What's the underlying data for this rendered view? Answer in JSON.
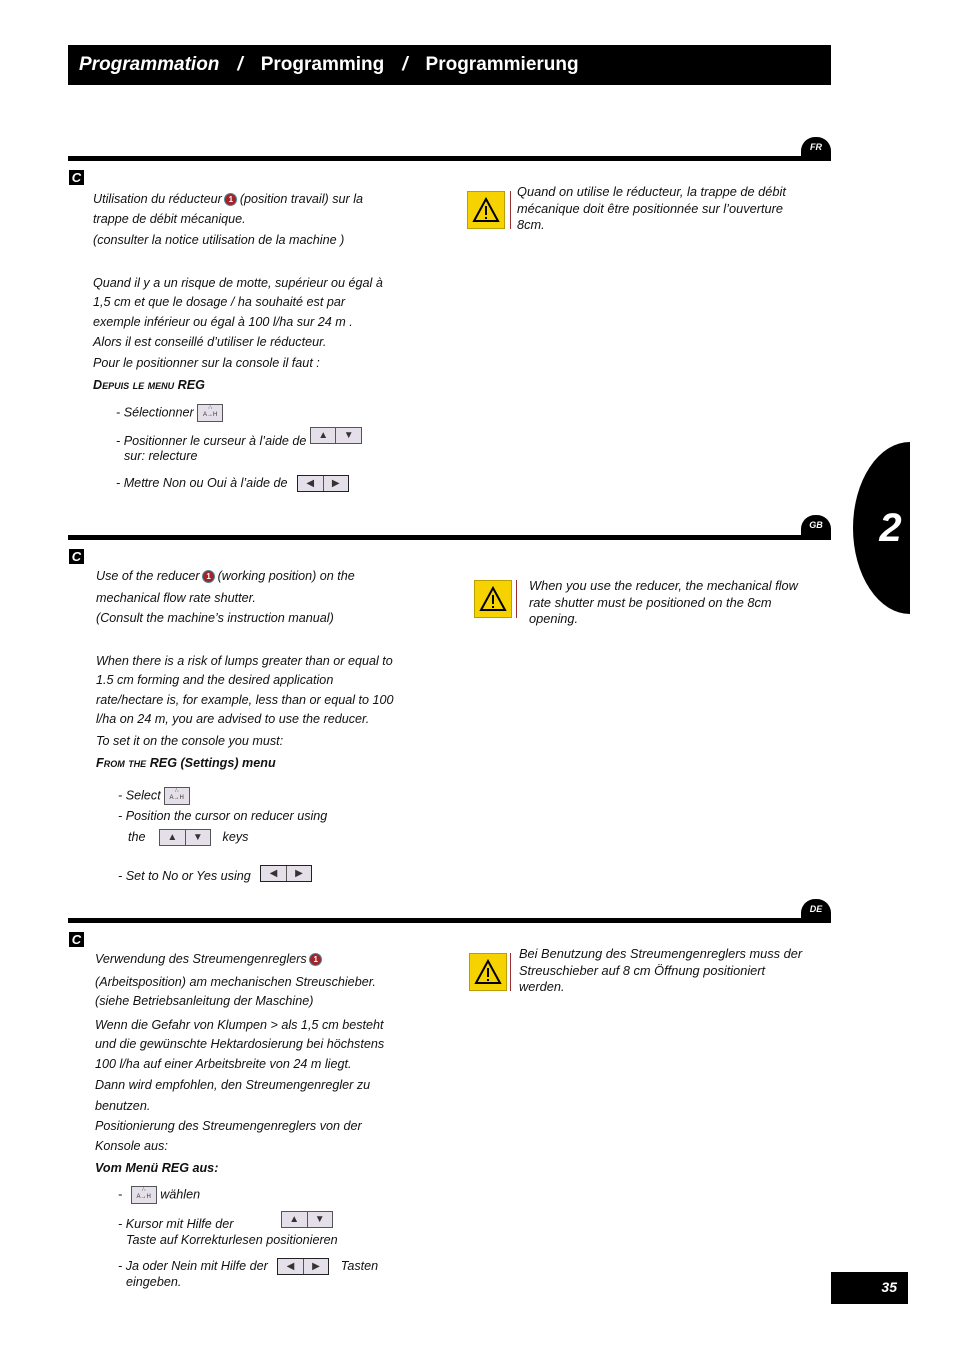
{
  "header": {
    "title_fr": "Programmation",
    "separator": "/",
    "title_gb": "Programming",
    "title_de": "Programmierung"
  },
  "chapter_tab": "2",
  "page_number": "35",
  "icons": {
    "info_marker": "1",
    "select_key_glyph": "A→H",
    "up": "▲",
    "down": "▼",
    "left": "◀",
    "right": "▶",
    "warning": "warning-triangle-icon"
  },
  "sections": {
    "fr": {
      "lang": "FR",
      "marker": "C",
      "intro_a": "Utilisation du réducteur",
      "intro_b": "(position travail) sur la",
      "intro_c": "trappe de débit mécanique.",
      "intro_d": "(consulter la notice utilisation de la machine )",
      "para1": "Quand il y a un risque de motte, supérieur ou égal à",
      "para2": "1,5 cm et que le dosage / ha souhaité est par",
      "para3": "exemple inférieur ou égal à 100 l/ha sur 24 m .",
      "para4": "Alors il est conseillé d’utiliser le réducteur.",
      "para5": "Pour le positionner sur la console il faut :",
      "menu_title_sc": "Depuis le menu",
      "menu_title_b": "REG",
      "step1": "- Sélectionner",
      "step2a": "- Positionner le curseur à l’aide de",
      "step2b": "sur: relecture",
      "step3": "- Mettre Non ou Oui à l’aide de",
      "warning": "Quand on utilise le réducteur, la trappe de débit mécanique doit être positionnée sur l’ouverture 8cm."
    },
    "gb": {
      "lang": "GB",
      "marker": "C",
      "intro_a": "Use of the reducer",
      "intro_b": "(working position) on the",
      "intro_c": "mechanical flow rate shutter.",
      "intro_d": "(Consult the machine’s instruction manual)",
      "para1": "When there is a risk of lumps greater than or equal to",
      "para2": "1.5 cm forming and the desired application",
      "para3": "rate/hectare is, for example, less than or equal to 100",
      "para4": "l/ha on 24 m, you are advised to use the reducer.",
      "para5": "To set it on the console you must:",
      "menu_title_sc": "From the",
      "menu_title_b": "REG (Settings) menu",
      "step1": "- Select",
      "step2a": "- Position the cursor on reducer using",
      "step2b": "the",
      "step2c": "keys",
      "step3": "- Set to No or Yes using",
      "warning": "When you use the reducer, the mechanical flow rate shutter must be positioned on the 8cm opening."
    },
    "de": {
      "lang": "DE",
      "marker": "C",
      "intro_a": "Verwendung des Streumengenreglers",
      "intro_c": "(Arbeitsposition) am mechanischen Streuschieber.",
      "intro_d": "(siehe Betriebsanleitung der Maschine)",
      "para1": "Wenn die Gefahr von Klumpen > als 1,5 cm besteht",
      "para2": "und die gewünschte Hektardosierung bei höchstens",
      "para3": "100 l/ha auf einer Arbeitsbreite von 24 m liegt.",
      "para4": "Dann wird empfohlen, den Streumengenregler zu",
      "para4b": "benutzen.",
      "para5": "Positionierung des Streumengenreglers von der",
      "para5b": "Konsole aus:",
      "menu_title_b": "Vom Menü REG aus:",
      "step1a": "-",
      "step1b": "wählen",
      "step2a": "- Kursor mit Hilfe der",
      "step2b": "Taste auf Korrekturlesen positionieren",
      "step3a": "- Ja oder Nein mit Hilfe der",
      "step3b": "Tasten",
      "step3c": "eingeben.",
      "warning": "Bei Benutzung des Streumengenreglers muss der Streuschieber auf 8 cm Öffnung positioniert werden."
    }
  }
}
